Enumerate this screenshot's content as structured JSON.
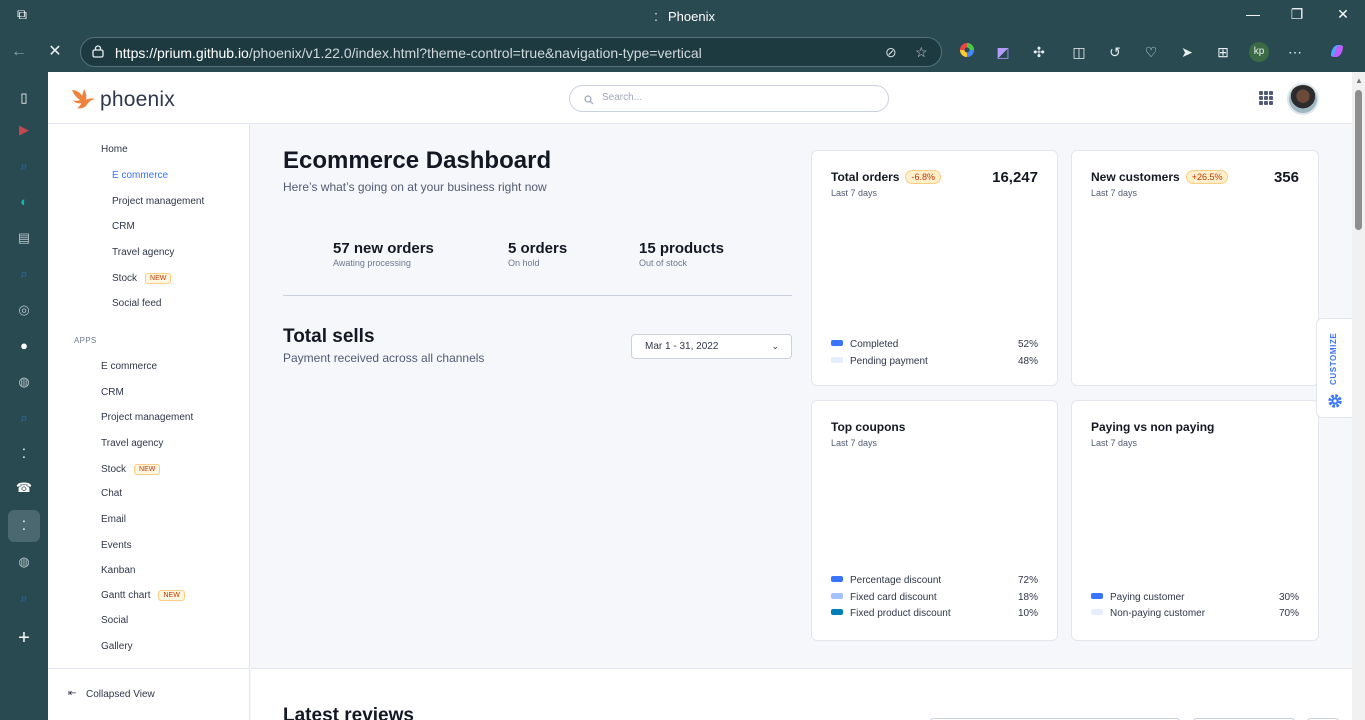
{
  "browser": {
    "tab_title": "Phoenix",
    "url_host": "https://prium.github.io",
    "url_path": "/phoenix/v1.22.0/index.html?theme-control=true&navigation-type=vertical",
    "profile_initials": "kp"
  },
  "header": {
    "brand": "phoenix",
    "search_placeholder": "Search..."
  },
  "sidebar": {
    "home": "Home",
    "home_items": [
      {
        "label": "E commerce",
        "active": true
      },
      {
        "label": "Project management"
      },
      {
        "label": "CRM"
      },
      {
        "label": "Travel agency"
      },
      {
        "label": "Stock",
        "badge": "NEW"
      },
      {
        "label": "Social feed"
      }
    ],
    "apps_section": "APPS",
    "apps_items": [
      {
        "label": "E commerce"
      },
      {
        "label": "CRM"
      },
      {
        "label": "Project management"
      },
      {
        "label": "Travel agency"
      },
      {
        "label": "Stock",
        "badge": "NEW"
      },
      {
        "label": "Chat"
      },
      {
        "label": "Email"
      },
      {
        "label": "Events"
      },
      {
        "label": "Kanban"
      },
      {
        "label": "Gantt chart",
        "badge": "NEW"
      },
      {
        "label": "Social"
      },
      {
        "label": "Gallery"
      }
    ],
    "collapsed_view": "Collapsed View"
  },
  "dashboard": {
    "title": "Ecommerce Dashboard",
    "subtitle": "Here’s what’s going on at your business right now",
    "stats": [
      {
        "value": "57 new orders",
        "label": "Awating processing"
      },
      {
        "value": "5 orders",
        "label": "On hold"
      },
      {
        "value": "15 products",
        "label": "Out of stock"
      }
    ],
    "total_sells": {
      "title": "Total sells",
      "subtitle": "Payment received across all channels",
      "date_range": "Mar 1 - 31, 2022"
    },
    "latest_reviews": "Latest reviews"
  },
  "cards": {
    "total_orders": {
      "title": "Total orders",
      "badge": "-6.8%",
      "value": "16,247",
      "period": "Last 7 days",
      "legend": [
        {
          "label": "Completed",
          "pct": "52%",
          "color": "#3874ff"
        },
        {
          "label": "Pending payment",
          "pct": "48%",
          "color": "#e5edff"
        }
      ]
    },
    "new_customers": {
      "title": "New customers",
      "badge": "+26.5%",
      "value": "356",
      "period": "Last 7 days"
    },
    "top_coupons": {
      "title": "Top coupons",
      "period": "Last 7 days",
      "legend": [
        {
          "label": "Percentage discount",
          "pct": "72%",
          "color": "#3874ff"
        },
        {
          "label": "Fixed card discount",
          "pct": "18%",
          "color": "#a3c0ff"
        },
        {
          "label": "Fixed product discount",
          "pct": "10%",
          "color": "#0080b5"
        }
      ]
    },
    "paying": {
      "title": "Paying vs non paying",
      "period": "Last 7 days",
      "legend": [
        {
          "label": "Paying customer",
          "pct": "30%",
          "color": "#3874ff"
        },
        {
          "label": "Non-paying customer",
          "pct": "70%",
          "color": "#e5edff"
        }
      ]
    }
  },
  "customize": "CUSTOMIZE"
}
